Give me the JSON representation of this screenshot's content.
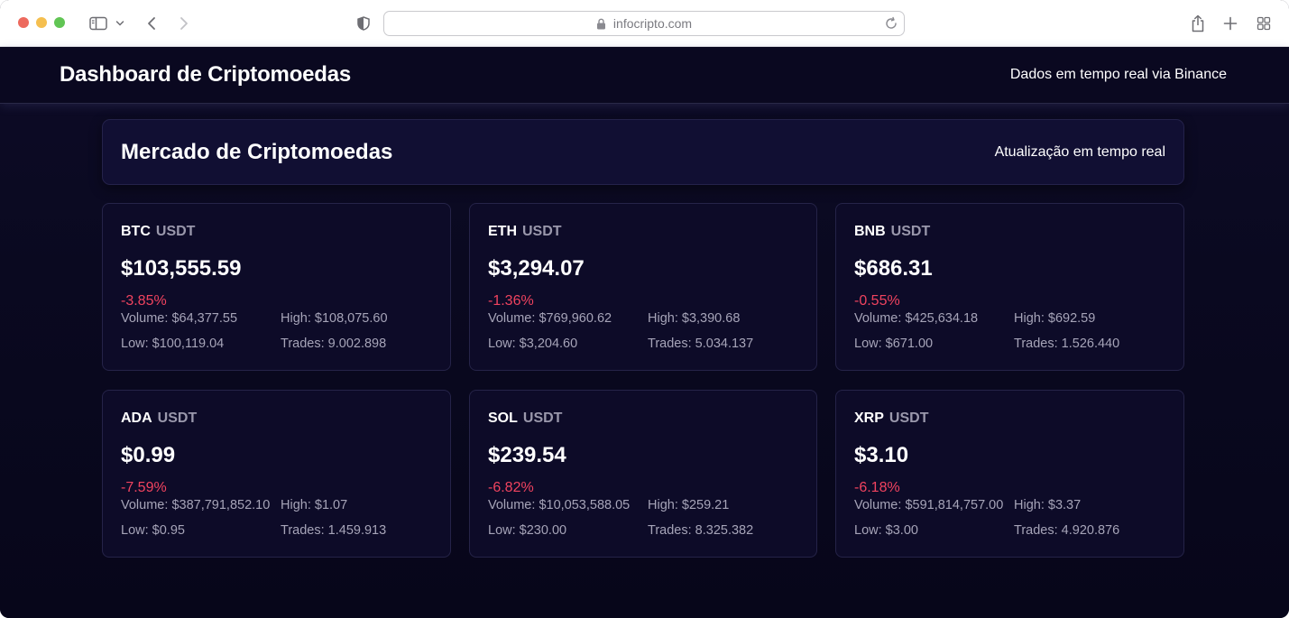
{
  "browser": {
    "url": "infocripto.com"
  },
  "header": {
    "title": "Dashboard de Criptomoedas",
    "subtitle": "Dados em tempo real via Binance"
  },
  "market": {
    "title": "Mercado de Criptomoedas",
    "subtitle": "Atualização em tempo real"
  },
  "colors": {
    "negative": "#f0435f",
    "background": "#07061a",
    "card": "#0d0b28"
  },
  "coins": [
    {
      "base": "BTC",
      "quote": "USDT",
      "price": "$103,555.59",
      "change": "-3.85%",
      "volume_label": "Volume:",
      "volume": "$64,377.55",
      "high_label": "High:",
      "high": "$108,075.60",
      "low_label": "Low:",
      "low": "$100,119.04",
      "trades_label": "Trades:",
      "trades": "9.002.898"
    },
    {
      "base": "ETH",
      "quote": "USDT",
      "price": "$3,294.07",
      "change": "-1.36%",
      "volume_label": "Volume:",
      "volume": "$769,960.62",
      "high_label": "High:",
      "high": "$3,390.68",
      "low_label": "Low:",
      "low": "$3,204.60",
      "trades_label": "Trades:",
      "trades": "5.034.137"
    },
    {
      "base": "BNB",
      "quote": "USDT",
      "price": "$686.31",
      "change": "-0.55%",
      "volume_label": "Volume:",
      "volume": "$425,634.18",
      "high_label": "High:",
      "high": "$692.59",
      "low_label": "Low:",
      "low": "$671.00",
      "trades_label": "Trades:",
      "trades": "1.526.440"
    },
    {
      "base": "ADA",
      "quote": "USDT",
      "price": "$0.99",
      "change": "-7.59%",
      "volume_label": "Volume:",
      "volume": "$387,791,852.10",
      "high_label": "High:",
      "high": "$1.07",
      "low_label": "Low:",
      "low": "$0.95",
      "trades_label": "Trades:",
      "trades": "1.459.913"
    },
    {
      "base": "SOL",
      "quote": "USDT",
      "price": "$239.54",
      "change": "-6.82%",
      "volume_label": "Volume:",
      "volume": "$10,053,588.05",
      "high_label": "High:",
      "high": "$259.21",
      "low_label": "Low:",
      "low": "$230.00",
      "trades_label": "Trades:",
      "trades": "8.325.382"
    },
    {
      "base": "XRP",
      "quote": "USDT",
      "price": "$3.10",
      "change": "-6.18%",
      "volume_label": "Volume:",
      "volume": "$591,814,757.00",
      "high_label": "High:",
      "high": "$3.37",
      "low_label": "Low:",
      "low": "$3.00",
      "trades_label": "Trades:",
      "trades": "4.920.876"
    }
  ]
}
